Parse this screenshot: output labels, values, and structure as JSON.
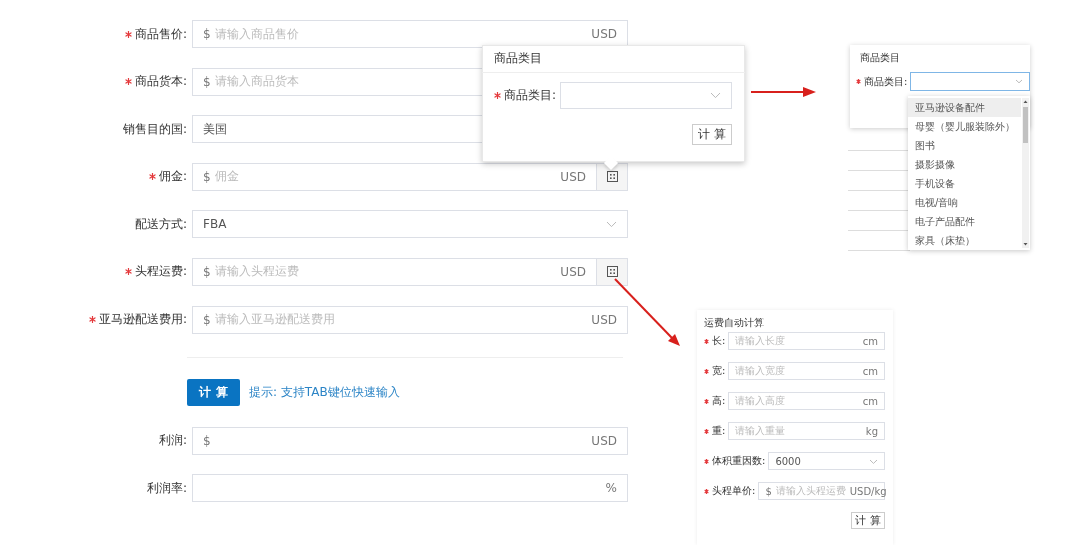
{
  "form": {
    "fields": [
      {
        "kind": "input",
        "label": "商品售价:",
        "required": true,
        "prefix": "$",
        "placeholder": "请输入商品售价",
        "suffix": "USD",
        "calculator": false
      },
      {
        "kind": "input",
        "label": "商品货本:",
        "required": true,
        "prefix": "$",
        "placeholder": "请输入商品货本",
        "calculator": false
      },
      {
        "kind": "input",
        "label": "销售目的国:",
        "required": false,
        "value": "美国",
        "calculator": false
      },
      {
        "kind": "input",
        "label": "佣金:",
        "required": true,
        "prefix": "$",
        "placeholder": "佣金",
        "suffix": "USD",
        "calculator": true
      },
      {
        "kind": "select",
        "label": "配送方式:",
        "required": false,
        "value": "FBA",
        "calculator": false
      },
      {
        "kind": "input",
        "label": "头程运费:",
        "required": true,
        "prefix": "$",
        "placeholder": "请输入头程运费",
        "suffix": "USD",
        "calculator": true
      },
      {
        "kind": "input",
        "label": "亚马逊配送费用:",
        "required": true,
        "prefix": "$",
        "placeholder": "请输入亚马逊配送费用",
        "suffix": "USD",
        "calculator": false
      }
    ],
    "button": "计 算",
    "hint": "提示: 支持TAB键位快速输入",
    "results": [
      {
        "kind": "input",
        "label": "利润:",
        "required": false,
        "prefix": "$",
        "suffix": "USD",
        "calculator": false
      },
      {
        "kind": "input",
        "label": "利润率:",
        "required": false,
        "suffix": "%",
        "calculator": false
      }
    ]
  },
  "category_popover": {
    "title": "商品类目",
    "field": {
      "label": "商品类目:",
      "required": true
    },
    "button": "计 算"
  },
  "category_panel": {
    "title": "商品类目",
    "field": {
      "label": "商品类目:",
      "required": true
    },
    "options": [
      {
        "label": "亚马逊设备配件",
        "selected": true
      },
      {
        "label": "母婴（婴儿服装除外）",
        "selected": false
      },
      {
        "label": "图书",
        "selected": false
      },
      {
        "label": "摄影摄像",
        "selected": false
      },
      {
        "label": "手机设备",
        "selected": false
      },
      {
        "label": "电视/音响",
        "selected": false
      },
      {
        "label": "电子产品配件",
        "selected": false
      },
      {
        "label": "家具（床垫）",
        "selected": false
      }
    ]
  },
  "freight_panel": {
    "title": "运费自动计算",
    "fields": [
      {
        "kind": "input",
        "label": "长:",
        "required": true,
        "placeholder": "请输入长度",
        "suffix": "cm"
      },
      {
        "kind": "input",
        "label": "宽:",
        "required": true,
        "placeholder": "请输入宽度",
        "suffix": "cm"
      },
      {
        "kind": "input",
        "label": "高:",
        "required": true,
        "placeholder": "请输入高度",
        "suffix": "cm"
      },
      {
        "kind": "input",
        "label": "重:",
        "required": true,
        "placeholder": "请输入重量",
        "suffix": "kg"
      },
      {
        "kind": "select",
        "label": "体积重因数:",
        "required": true,
        "value": "6000"
      },
      {
        "kind": "input",
        "label": "头程单价:",
        "required": true,
        "prefix": "$",
        "placeholder": "请输入头程运费",
        "suffix": "USD/kg"
      }
    ],
    "button": "计 算"
  }
}
